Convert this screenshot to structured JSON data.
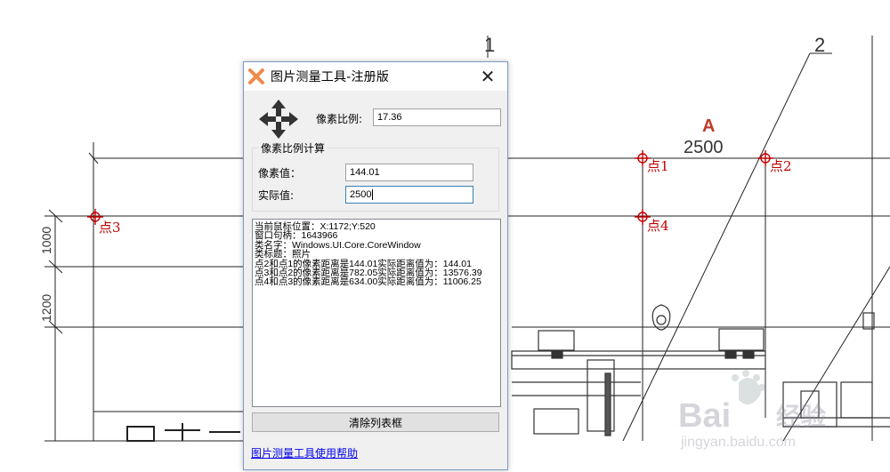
{
  "drawing": {
    "column_labels": [
      "1",
      "2"
    ],
    "section_letter": "A",
    "dimension": "2500",
    "side_dimensions": [
      "1000",
      "1200"
    ],
    "points": [
      {
        "label": "点1"
      },
      {
        "label": "点2"
      },
      {
        "label": "点3"
      },
      {
        "label": "点4"
      }
    ],
    "marker_color": "#c00000",
    "watermark": {
      "brand": "Bai",
      "brand_cn": "经验",
      "url": "jingyan.baidu.com"
    }
  },
  "dialog": {
    "title": "图片测量工具-注册版",
    "close_glyph": "✕",
    "scale_label": "像素比例:",
    "scale_value": "17.36",
    "group_title": "像素比例计算",
    "pixel_label": "像素值：",
    "pixel_value": "144.01",
    "actual_label": "实际值:",
    "actual_value": "2500",
    "log_lines": [
      "当前鼠标位置：X:1172;Y:520",
      "窗口句柄：1643966",
      "类名字：Windows.UI.Core.CoreWindow",
      "类标题：照片",
      "点2和点1的像素距离是144.01实际距离值为：144.01",
      "点3和点2的像素距离是782.05实际距离值为：13576.39",
      "点4和点3的像素距离是634.00实际距离值为：11006.25"
    ],
    "clear_button": "清除列表框",
    "help_link": "图片测量工具使用帮助",
    "accent_color": "#3c7fb1",
    "link_color": "#0000ee"
  }
}
